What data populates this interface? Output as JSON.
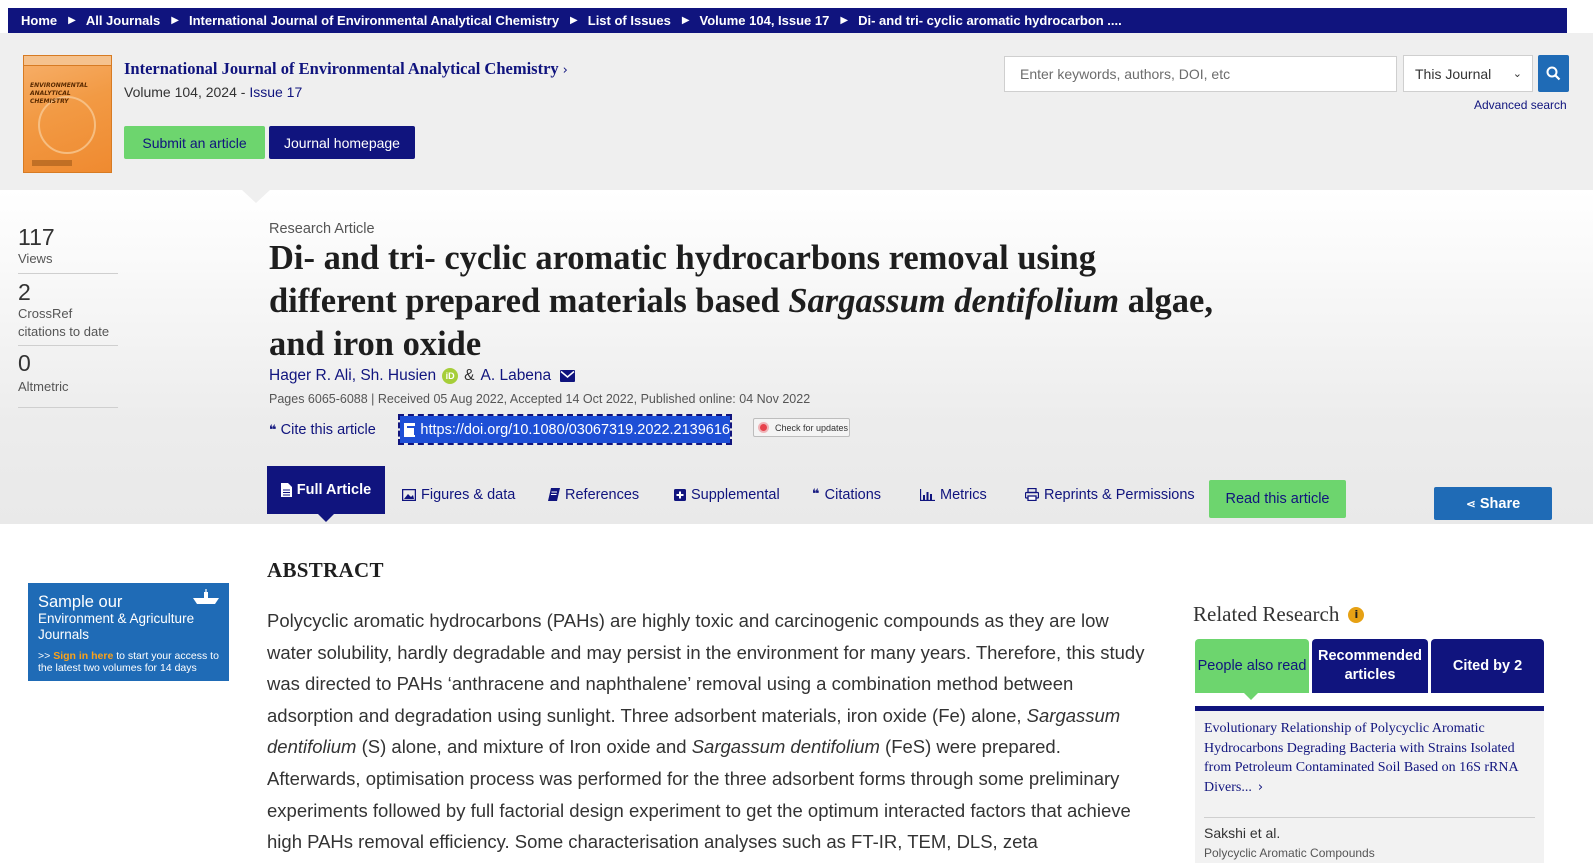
{
  "breadcrumb": {
    "items": [
      "Home",
      "All Journals",
      "International Journal of Environmental Analytical Chemistry",
      "List of Issues",
      "Volume 104, Issue 17",
      "Di- and tri- cyclic aromatic hydrocarbon ...."
    ]
  },
  "journal": {
    "title": "International Journal of Environmental Analytical Chemistry",
    "chevron": "›",
    "volume_prefix": "Volume 104, 2024 - ",
    "issue": "Issue 17",
    "cover_lines": [
      "ENVIRONMENTAL",
      "ANALYTICAL",
      "CHEMISTRY"
    ],
    "submit_label": "Submit an article",
    "homepage_label": "Journal homepage"
  },
  "search": {
    "placeholder": "Enter keywords, authors, DOI, etc",
    "scope": "This Journal",
    "advanced_label": "Advanced search"
  },
  "metrics": [
    {
      "value": "117",
      "label": "Views"
    },
    {
      "value": "2",
      "label": "CrossRef citations to date"
    },
    {
      "value": "0",
      "label": "Altmetric"
    }
  ],
  "article": {
    "type": "Research Article",
    "title_part1": "Di- and tri- cyclic aromatic hydrocarbons removal using different prepared materials based ",
    "title_italic": "Sargassum dentifolium",
    "title_part2": " algae, and iron oxide",
    "authors": [
      "Hager R. Ali",
      "Sh. Husien",
      "A. Labena"
    ],
    "author_sep": ",",
    "and_sep": "&",
    "orcid_glyph": "iD",
    "pages_line": "Pages 6065-6088 | Received 05 Aug 2022, Accepted 14 Oct 2022, Published online: 04 Nov 2022",
    "cite_label": "Cite this article",
    "doi": "https://doi.org/10.1080/03067319.2022.2139616",
    "check_updates": "Check for updates"
  },
  "tabs": [
    {
      "label": "Full Article",
      "icon": "document-icon",
      "active": true
    },
    {
      "label": "Figures & data",
      "icon": "image-icon"
    },
    {
      "label": "References",
      "icon": "book-icon"
    },
    {
      "label": "Supplemental",
      "icon": "plus-square-icon"
    },
    {
      "label": "Citations",
      "icon": "quote-icon"
    },
    {
      "label": "Metrics",
      "icon": "bar-chart-icon"
    },
    {
      "label": "Reprints & Permissions",
      "icon": "print-icon"
    }
  ],
  "read_article_label": "Read this article",
  "share_label": "Share",
  "abstract": {
    "heading": "ABSTRACT",
    "p1": "Polycyclic aromatic hydrocarbons (PAHs) are highly toxic and carcinogenic compounds as they are low water solubility, hardly degradable and may persist in the environment for many years. Therefore, this study was directed to PAHs ‘anthracene and naphthalene’ removal using a combination method between adsorption and degradation using sunlight. Three adsorbent materials, iron oxide (Fe) alone, ",
    "s1": "Sargassum dentifolium",
    "p2": " (S) alone, and mixture of Iron oxide and ",
    "s2": "Sargassum dentifolium",
    "p3": " (FeS) were prepared. Afterwards, optimisation process was performed for the three adsorbent forms through some preliminary experiments followed by full factorial design experiment to get the optimum interacted factors that achieve high PAHs removal efficiency. Some characterisation analyses such as FT-IR, TEM, DLS, zeta"
  },
  "ad": {
    "line1": "Sample our",
    "line2": "Environment & Agriculture Journals",
    "prefix": ">> ",
    "sign_in": "Sign in here",
    "rest": " to start your access to the latest two volumes for 14 days"
  },
  "related": {
    "heading": "Related Research",
    "info_glyph": "i",
    "tabs": [
      "People also read",
      "Recommended articles",
      "Cited by 2"
    ],
    "item_title": "Evolutionary Relationship of Polycyclic Aromatic Hydrocarbons Degrading Bacteria with Strains Isolated from Petroleum Contaminated Soil Based on 16S rRNA Divers...",
    "item_more": "›",
    "item_authors": "Sakshi   et al.",
    "item_journal": "Polycyclic Aromatic Compounds"
  },
  "colors": {
    "navy": "#10147e",
    "green": "#6dd56e",
    "blue": "#1f6bb6",
    "orcid": "#a6ce39"
  }
}
